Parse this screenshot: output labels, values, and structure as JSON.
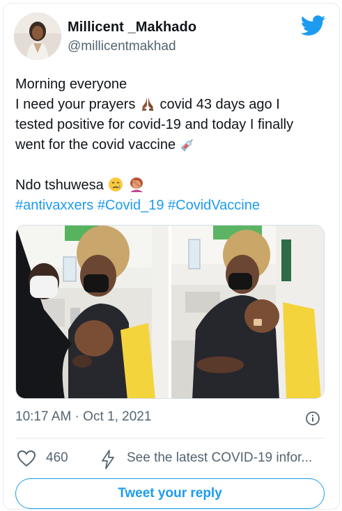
{
  "author": {
    "display_name": "Millicent _Makhado",
    "handle": "@millicentmakhad"
  },
  "tweet": {
    "lines": [
      "Morning everyone",
      "I need your prayers",
      "covid 43 days ago I",
      "tested positive for covid-19 and today I finally",
      "went for the covid vaccine",
      "Ndo tshuwesa"
    ],
    "hashtags": [
      "#antivaxxers",
      "#Covid_19",
      "#CovidVaccine"
    ],
    "emojis": [
      "folded-hands-medium-dark",
      "syringe",
      "crying-face",
      "person-facepalming"
    ]
  },
  "media": {
    "photo_count": 2
  },
  "meta": {
    "timestamp": "10:17 AM · Oct 1, 2021"
  },
  "actions": {
    "like_count": "460",
    "covid_link": "See the latest COVID-19 infor..."
  },
  "reply_button": {
    "label": "Tweet your reply"
  },
  "colors": {
    "accent": "#1d9bf0",
    "text_primary": "#0f1419",
    "text_secondary": "#536471",
    "border": "#e6ecf0"
  },
  "icons": [
    "twitter-bird-icon",
    "info-icon",
    "heart-icon",
    "lightning-bolt-icon"
  ]
}
